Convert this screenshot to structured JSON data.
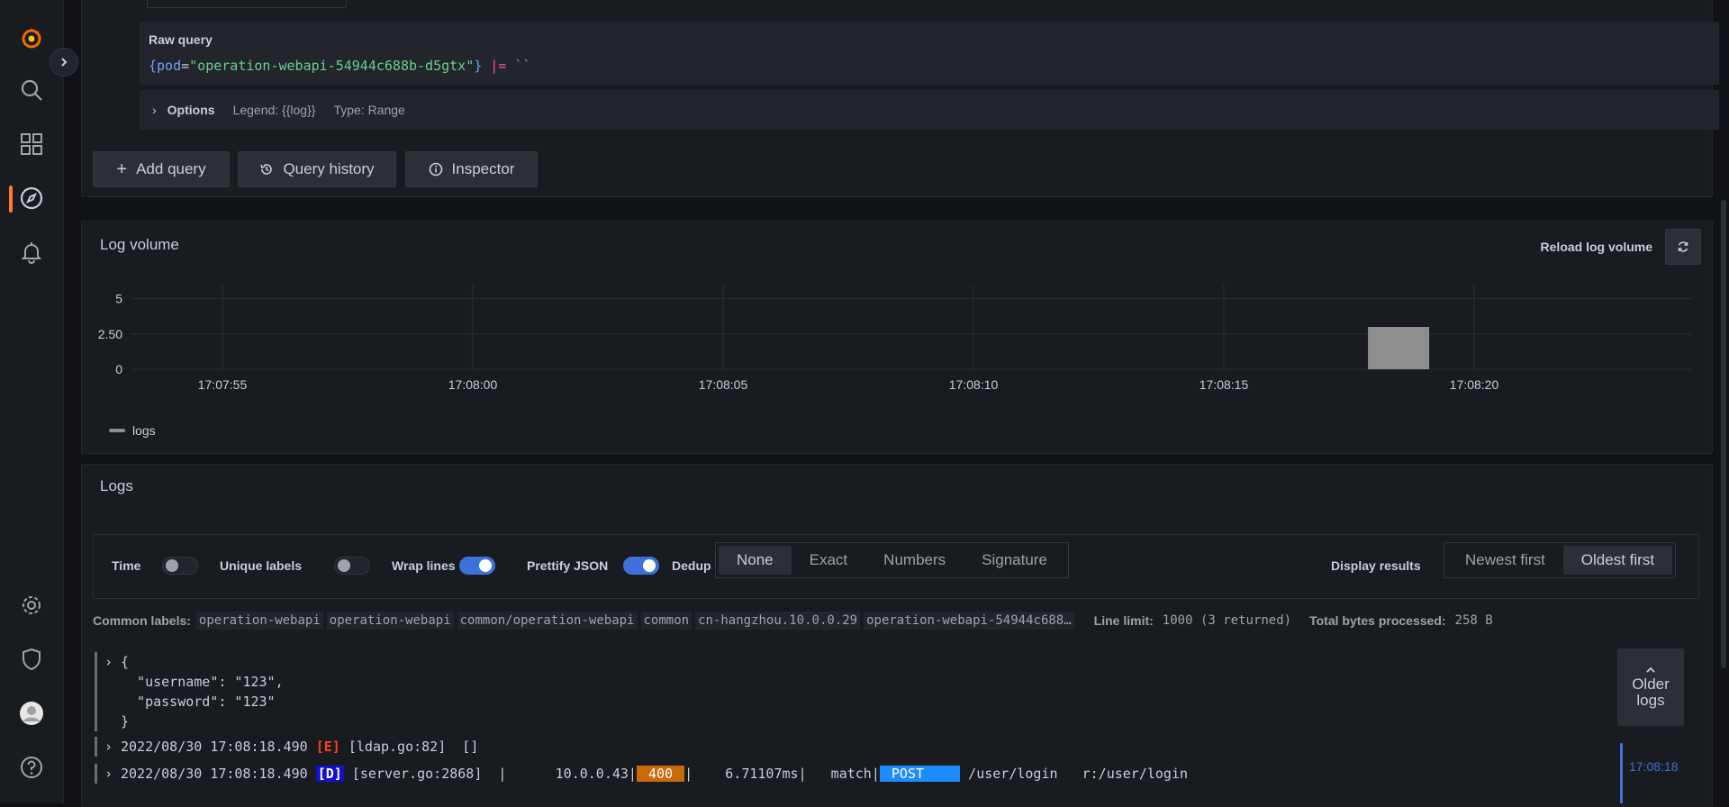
{
  "sidebar": {
    "items": [
      "grafana-logo",
      "search",
      "dashboards",
      "explore",
      "alerting",
      "configuration",
      "server-admin",
      "profile",
      "help"
    ]
  },
  "query": {
    "raw_label": "Raw query",
    "code_open": "{",
    "code_key": "pod",
    "code_eq": "=",
    "code_val": "\"operation-webapi-54944c688b-d5gtx\"",
    "code_close": "}",
    "code_pipe": "|=",
    "code_tail": "``",
    "options_label": "Options",
    "legend_info": "Legend: {{log}}",
    "type_info": "Type: Range"
  },
  "toolbar": {
    "add_query": "Add query",
    "query_history": "Query history",
    "inspector": "Inspector"
  },
  "log_volume": {
    "title": "Log volume",
    "reload_label": "Reload log volume"
  },
  "chart_data": {
    "type": "bar",
    "x_ticks": [
      "17:07:55",
      "17:08:00",
      "17:08:05",
      "17:08:10",
      "17:08:15",
      "17:08:20"
    ],
    "y_ticks": [
      "0",
      "2.50",
      "5"
    ],
    "ylim": [
      0,
      6
    ],
    "series": [
      {
        "name": "logs",
        "color": "#8e8e8e",
        "points": [
          {
            "x": "17:08:18.490",
            "y": 3
          }
        ]
      }
    ],
    "grid": true,
    "legend": "bottom-left"
  },
  "logs": {
    "title": "Logs",
    "controls": {
      "time": "Time",
      "unique_labels": "Unique labels",
      "wrap_lines": "Wrap lines",
      "prettify_json": "Prettify JSON",
      "dedup": "Dedup",
      "dedup_options": [
        "None",
        "Exact",
        "Numbers",
        "Signature"
      ],
      "display_results": "Display results",
      "order_options": [
        "Newest first",
        "Oldest first"
      ]
    },
    "common_labels_key": "Common labels:",
    "common_labels": [
      "operation-webapi",
      "operation-webapi",
      "common/operation-webapi",
      "common",
      "cn-hangzhou.10.0.0.29",
      "operation-webapi-54944c688…"
    ],
    "line_limit_key": "Line limit:",
    "line_limit_val": "1000 (3 returned)",
    "bytes_key": "Total bytes processed:",
    "bytes_val": "258 B",
    "line1": {
      "brace_open": "{",
      "user": "  \"username\": \"123\",",
      "pass": "  \"password\": \"123\"",
      "brace_close": "}"
    },
    "line2": {
      "ts": "2022/08/30 17:08:18.490",
      "lvl": "[E]",
      "msg": " [ldap.go:82]  []"
    },
    "line3": {
      "ts": "2022/08/30 17:08:18.490",
      "lvl": "[D]",
      "msg_a": " [server.go:2868]  |      10.0.0.43|",
      "code": " 400 ",
      "msg_b": "|    6.71107ms|   match|",
      "method": " POST    ",
      "msg_c": " /user/login   r:/user/login"
    },
    "older_logs": "Older logs",
    "timeline_time": "17:08:18"
  }
}
